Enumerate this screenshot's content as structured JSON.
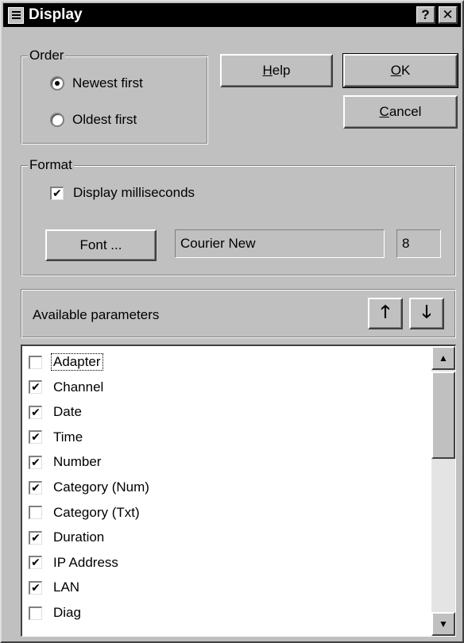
{
  "window": {
    "title": "Display",
    "help_glyph": "?",
    "close_glyph": "✕"
  },
  "order": {
    "legend": "Order",
    "options": [
      {
        "label": "Newest first",
        "selected": true
      },
      {
        "label": "Oldest first",
        "selected": false
      }
    ]
  },
  "buttons": {
    "help": {
      "mnemonic": "H",
      "rest": "elp"
    },
    "ok": {
      "mnemonic": "O",
      "rest": "K"
    },
    "cancel": {
      "mnemonic": "C",
      "rest": "ancel"
    }
  },
  "format": {
    "legend": "Format",
    "display_ms_label": "Display milliseconds",
    "display_ms_checked": true,
    "font_button": "Font ...",
    "font_name": "Courier New",
    "font_size": "8"
  },
  "parameters": {
    "header": "Available parameters",
    "up_glyph": "🡑",
    "down_glyph": "🡓",
    "check_glyph": "✔",
    "items": [
      {
        "label": "Adapter",
        "checked": false,
        "focused": true
      },
      {
        "label": "Channel",
        "checked": true
      },
      {
        "label": "Date",
        "checked": true
      },
      {
        "label": "Time",
        "checked": true
      },
      {
        "label": "Number",
        "checked": true
      },
      {
        "label": "Category (Num)",
        "checked": true
      },
      {
        "label": "Category (Txt)",
        "checked": false
      },
      {
        "label": "Duration",
        "checked": true
      },
      {
        "label": "IP Address",
        "checked": true
      },
      {
        "label": "LAN",
        "checked": true
      },
      {
        "label": "Diag",
        "checked": false
      }
    ],
    "scroll_up_glyph": "▲",
    "scroll_down_glyph": "▼"
  }
}
